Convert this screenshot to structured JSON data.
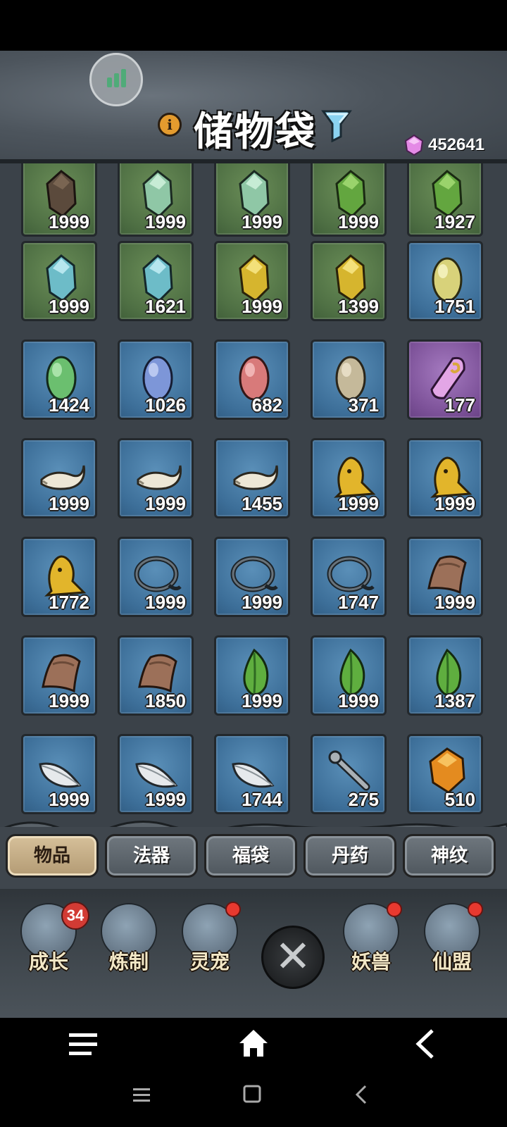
{
  "header": {
    "title": "储物袋",
    "info_icon_glyph": "i",
    "currency_value": "452641",
    "icons": [
      "signal-icon",
      "info-icon",
      "filter-icon",
      "gem-icon"
    ]
  },
  "items": [
    {
      "count": "1999",
      "icon": "dark-ore-icon",
      "bg": "green"
    },
    {
      "count": "1999",
      "icon": "jade-ore-icon",
      "bg": "green"
    },
    {
      "count": "1999",
      "icon": "jade-ore-icon",
      "bg": "green"
    },
    {
      "count": "1999",
      "icon": "green-ore-icon",
      "bg": "green"
    },
    {
      "count": "1927",
      "icon": "green-ore-icon",
      "bg": "green"
    },
    {
      "count": "1999",
      "icon": "cyan-ore-icon",
      "bg": "green"
    },
    {
      "count": "1621",
      "icon": "cyan-ore-icon",
      "bg": "green"
    },
    {
      "count": "1999",
      "icon": "yellow-ore-icon",
      "bg": "green"
    },
    {
      "count": "1399",
      "icon": "yellow-ore-icon",
      "bg": "green"
    },
    {
      "count": "1751",
      "icon": "yellow-stone-icon",
      "bg": "blue"
    },
    {
      "count": "1424",
      "icon": "green-stone-icon",
      "bg": "blue"
    },
    {
      "count": "1026",
      "icon": "blue-stone-icon",
      "bg": "blue"
    },
    {
      "count": "682",
      "icon": "red-stone-icon",
      "bg": "blue"
    },
    {
      "count": "371",
      "icon": "grey-stone-icon",
      "bg": "blue"
    },
    {
      "count": "177",
      "icon": "scroll-icon",
      "bg": "purple"
    },
    {
      "count": "1999",
      "icon": "horn-icon",
      "bg": "blue"
    },
    {
      "count": "1999",
      "icon": "horn-icon",
      "bg": "blue"
    },
    {
      "count": "1455",
      "icon": "horn-icon",
      "bg": "blue"
    },
    {
      "count": "1999",
      "icon": "golden-idol-icon",
      "bg": "blue"
    },
    {
      "count": "1999",
      "icon": "golden-idol-icon",
      "bg": "blue"
    },
    {
      "count": "1772",
      "icon": "golden-idol-icon",
      "bg": "blue"
    },
    {
      "count": "1999",
      "icon": "rope-icon",
      "bg": "blue"
    },
    {
      "count": "1999",
      "icon": "rope-icon",
      "bg": "blue"
    },
    {
      "count": "1747",
      "icon": "rope-icon",
      "bg": "blue"
    },
    {
      "count": "1999",
      "icon": "hide-icon",
      "bg": "blue"
    },
    {
      "count": "1999",
      "icon": "hide-icon",
      "bg": "blue"
    },
    {
      "count": "1850",
      "icon": "hide-icon",
      "bg": "blue"
    },
    {
      "count": "1999",
      "icon": "leaf-icon",
      "bg": "blue"
    },
    {
      "count": "1999",
      "icon": "leaf-icon",
      "bg": "blue"
    },
    {
      "count": "1387",
      "icon": "leaf-icon",
      "bg": "blue"
    },
    {
      "count": "1999",
      "icon": "feather-icon",
      "bg": "blue"
    },
    {
      "count": "1999",
      "icon": "feather-icon",
      "bg": "blue"
    },
    {
      "count": "1744",
      "icon": "feather-icon",
      "bg": "blue"
    },
    {
      "count": "275",
      "icon": "bone-icon",
      "bg": "blue"
    },
    {
      "count": "510",
      "icon": "amber-icon",
      "bg": "blue"
    }
  ],
  "tabs": [
    {
      "label": "物品",
      "active": true
    },
    {
      "label": "法器",
      "active": false
    },
    {
      "label": "福袋",
      "active": false
    },
    {
      "label": "丹药",
      "active": false
    },
    {
      "label": "神纹",
      "active": false
    }
  ],
  "bottom_nav": [
    {
      "label": "成长",
      "icon": "growth-icon",
      "badge": "34"
    },
    {
      "label": "炼制",
      "icon": "forge-icon",
      "badge": ""
    },
    {
      "label": "灵宠",
      "icon": "pet-icon",
      "badge": "dot"
    },
    {
      "label": "妖兽",
      "icon": "beast-icon",
      "badge": "dot"
    },
    {
      "label": "仙盟",
      "icon": "alliance-icon",
      "badge": "dot"
    }
  ],
  "close_button": {
    "glyph": "✕",
    "icon": "close-icon"
  },
  "system_nav": {
    "row1": [
      "menu-icon",
      "home-icon",
      "back-icon"
    ],
    "row2": [
      "menu-icon",
      "square-icon",
      "back-icon"
    ]
  }
}
